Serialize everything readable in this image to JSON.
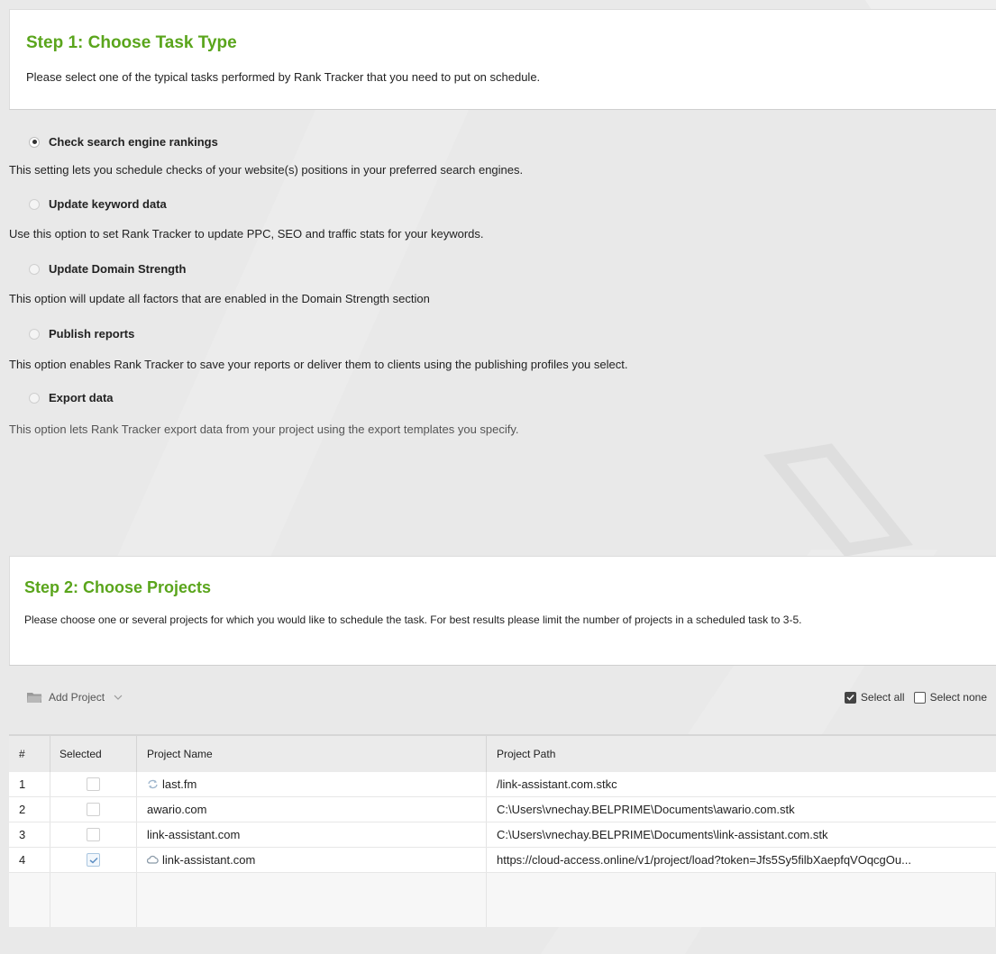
{
  "step1": {
    "title": "Step 1: Choose Task Type",
    "description": "Please select one of the typical tasks performed by Rank Tracker that you need to put on schedule."
  },
  "options": [
    {
      "label": "Check search engine rankings",
      "checked": true,
      "description": "This setting lets you schedule checks of your website(s) positions in your preferred search engines."
    },
    {
      "label": "Update keyword data",
      "checked": false,
      "description": "Use this option to set Rank Tracker to update PPC, SEO and traffic stats for your keywords."
    },
    {
      "label": "Update Domain Strength",
      "checked": false,
      "description": "This option will update all factors that are enabled in the Domain Strength section"
    },
    {
      "label": "Publish reports",
      "checked": false,
      "description": "This option enables Rank Tracker to save your reports or deliver them to clients using the publishing profiles you select."
    },
    {
      "label": "Export data",
      "checked": false,
      "description": "This option lets Rank Tracker export data from your project using the export templates you specify."
    }
  ],
  "step2": {
    "title": "Step 2: Choose Projects",
    "description": "Please choose one or several projects for which you would like to schedule the task. For best results please limit the number of projects in a scheduled task to 3-5."
  },
  "toolbar": {
    "add_project": "Add Project",
    "select_all": "Select all",
    "select_none": "Select none"
  },
  "table": {
    "headers": [
      "#",
      "Selected",
      "Project Name",
      "Project Path"
    ],
    "rows": [
      {
        "num": "1",
        "selected": false,
        "icon": "sync-icon",
        "name": "last.fm",
        "path": "/link-assistant.com.stkc"
      },
      {
        "num": "2",
        "selected": false,
        "icon": "",
        "name": "awario.com",
        "path": "C:\\Users\\vnechay.BELPRIME\\Documents\\awario.com.stk"
      },
      {
        "num": "3",
        "selected": false,
        "icon": "",
        "name": "link-assistant.com",
        "path": "C:\\Users\\vnechay.BELPRIME\\Documents\\link-assistant.com.stk"
      },
      {
        "num": "4",
        "selected": true,
        "icon": "cloud-icon",
        "name": "link-assistant.com",
        "path": "https://cloud-access.online/v1/project/load?token=Jfs5Sy5filbXaepfqVOqcgOu..."
      }
    ]
  },
  "colors": {
    "step_title": "#5aa51c",
    "panel_bg": "#e9e9e9",
    "header_bg": "#ffffff"
  }
}
